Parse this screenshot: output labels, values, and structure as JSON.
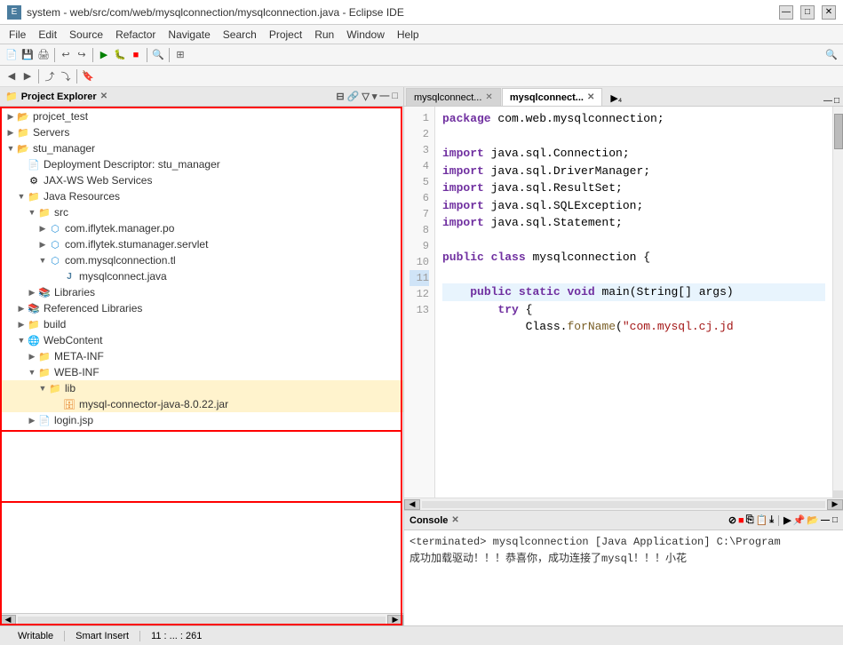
{
  "window": {
    "title": "system - web/src/com/web/mysqlconnection/mysqlconnection.java - Eclipse IDE",
    "icon": "E"
  },
  "menu": {
    "items": [
      "File",
      "Edit",
      "Source",
      "Refactor",
      "Navigate",
      "Search",
      "Project",
      "Run",
      "Window",
      "Help"
    ]
  },
  "left_panel": {
    "title": "Project Explorer",
    "close_label": "✕",
    "tree": [
      {
        "id": "projcet_test",
        "label": "projcet_test",
        "indent": 0,
        "type": "project",
        "arrow": "▶"
      },
      {
        "id": "servers",
        "label": "Servers",
        "indent": 0,
        "type": "folder",
        "arrow": "▶"
      },
      {
        "id": "stu_manager",
        "label": "stu_manager",
        "indent": 0,
        "type": "project",
        "arrow": "▼"
      },
      {
        "id": "deployment",
        "label": "Deployment Descriptor: stu_manager",
        "indent": 1,
        "type": "descriptor",
        "arrow": ""
      },
      {
        "id": "jaxws",
        "label": "JAX-WS Web Services",
        "indent": 1,
        "type": "service",
        "arrow": ""
      },
      {
        "id": "java_resources",
        "label": "Java Resources",
        "indent": 1,
        "type": "folder",
        "arrow": "▼"
      },
      {
        "id": "src",
        "label": "src",
        "indent": 2,
        "type": "folder",
        "arrow": "▼"
      },
      {
        "id": "pkg1",
        "label": "com.iflytek.manager.po",
        "indent": 3,
        "type": "package",
        "arrow": "▶"
      },
      {
        "id": "pkg2",
        "label": "com.iflytek.stumanager.servlet",
        "indent": 3,
        "type": "package",
        "arrow": "▶"
      },
      {
        "id": "pkg3",
        "label": "com.mysqlconnection.tl",
        "indent": 3,
        "type": "package",
        "arrow": "▼"
      },
      {
        "id": "mysqlconnect",
        "label": "mysqlconnect.java",
        "indent": 4,
        "type": "java",
        "arrow": ""
      },
      {
        "id": "libraries",
        "label": "Libraries",
        "indent": 2,
        "type": "folder",
        "arrow": "▶"
      },
      {
        "id": "ref_libraries",
        "label": "Referenced Libraries",
        "indent": 1,
        "type": "folder",
        "arrow": "▶"
      },
      {
        "id": "build",
        "label": "build",
        "indent": 1,
        "type": "folder",
        "arrow": "▶"
      },
      {
        "id": "webcontent",
        "label": "WebContent",
        "indent": 1,
        "type": "folder",
        "arrow": "▼"
      },
      {
        "id": "meta_inf",
        "label": "META-INF",
        "indent": 2,
        "type": "folder",
        "arrow": "▶"
      },
      {
        "id": "web_inf",
        "label": "WEB-INF",
        "indent": 2,
        "type": "folder",
        "arrow": "▼"
      },
      {
        "id": "lib",
        "label": "lib",
        "indent": 3,
        "type": "folder",
        "arrow": "▼"
      },
      {
        "id": "mysql_jar",
        "label": "mysql-connector-java-8.0.22.jar",
        "indent": 4,
        "type": "jar",
        "arrow": ""
      },
      {
        "id": "login_jsp",
        "label": "login.jsp",
        "indent": 2,
        "type": "jsp",
        "arrow": "▶"
      }
    ]
  },
  "editor": {
    "tabs": [
      {
        "label": "mysqlconnect...",
        "active": false,
        "closable": true
      },
      {
        "label": "mysqlconnect...",
        "active": true,
        "closable": true
      }
    ],
    "tab_menu": "▶₄",
    "lines": [
      {
        "num": 1,
        "text": "package com.web.mysqlconnection;"
      },
      {
        "num": 2,
        "text": ""
      },
      {
        "num": 3,
        "text": "import java.sql.Connection;"
      },
      {
        "num": 4,
        "text": "import java.sql.DriverManager;"
      },
      {
        "num": 5,
        "text": "import java.sql.ResultSet;"
      },
      {
        "num": 6,
        "text": "import java.sql.SQLException;"
      },
      {
        "num": 7,
        "text": "import java.sql.Statement;"
      },
      {
        "num": 8,
        "text": ""
      },
      {
        "num": 9,
        "text": "public class mysqlconnection {"
      },
      {
        "num": 10,
        "text": ""
      },
      {
        "num": 11,
        "text": "    public static void main(String[] args)",
        "highlight": true
      },
      {
        "num": 12,
        "text": "        try {"
      },
      {
        "num": 13,
        "text": "            Class.forName(\"com.mysql.cj.jd"
      }
    ]
  },
  "console": {
    "title": "Console",
    "close_symbol": "✕",
    "output": [
      "<terminated> mysqlconnection [Java Application] C:\\Program",
      "成功加载驱动！！！恭喜你，成功连接了mysql！！！小花"
    ]
  },
  "status_bar": {
    "mode": "Writable",
    "insert_mode": "Smart Insert",
    "position": "11 : ... : 261"
  },
  "icons": {
    "folder": "📁",
    "java": "J",
    "jar": "🗄",
    "package": "📦",
    "project": "📂",
    "descriptor": "📄",
    "service": "⚙",
    "jsp": "📄"
  },
  "colors": {
    "accent_blue": "#0078d7",
    "red_border": "#ff0000",
    "selected_bg": "#3399ff",
    "highlight_line": "#e8f4fd"
  }
}
